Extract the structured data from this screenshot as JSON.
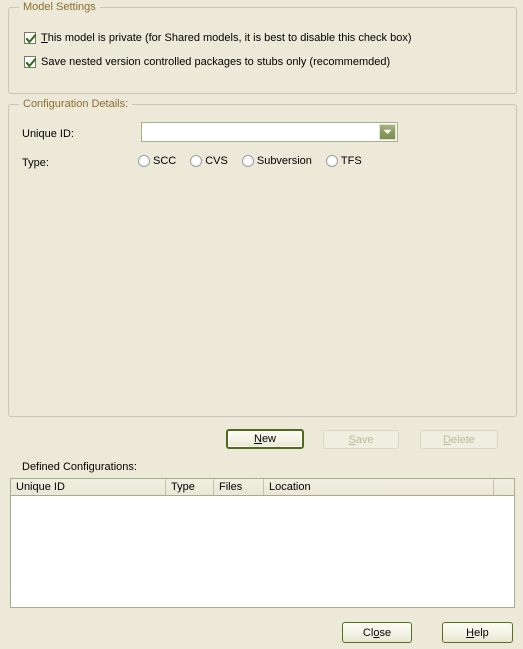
{
  "window": {
    "background_color": "#ece9d8",
    "accent_color": "#8c6d31",
    "border_color": "#a5b08a"
  },
  "model_settings": {
    "title": "Model Settings",
    "checkboxes": [
      {
        "name": "private-model",
        "mnemonic": "T",
        "label_rest": "his model is private (for Shared models, it is best to disable this check box)",
        "checked": true
      },
      {
        "name": "save-nested-stubs",
        "mnemonic": "",
        "label_rest": "Save nested version controlled packages to stubs only (recommemded)",
        "checked": true
      }
    ]
  },
  "configuration_details": {
    "title": "Configuration Details:",
    "unique_id": {
      "label": "Unique ID:",
      "value": "",
      "placeholder": ""
    },
    "type": {
      "label": "Type:",
      "options": [
        {
          "label": "SCC",
          "selected": false
        },
        {
          "label": "CVS",
          "selected": false
        },
        {
          "label": "Subversion",
          "selected": false
        },
        {
          "label": "TFS",
          "selected": false
        }
      ]
    }
  },
  "action_buttons": [
    {
      "name": "new-button",
      "mnemonic": "N",
      "label_rest": "ew",
      "state": "focused"
    },
    {
      "name": "save-button",
      "mnemonic": "S",
      "label_rest": "ave",
      "state": "disabled"
    },
    {
      "name": "delete-button",
      "mnemonic": "D",
      "label_rest": "elete",
      "state": "disabled"
    }
  ],
  "defined_configurations": {
    "label": "Defined Configurations:",
    "columns": [
      "Unique ID",
      "Type",
      "Files",
      "Location"
    ],
    "rows": []
  },
  "dialog_buttons": [
    {
      "name": "close-button",
      "pre": "Cl",
      "mnemonic": "o",
      "post": "se",
      "state": "normal"
    },
    {
      "name": "help-button",
      "pre": "",
      "mnemonic": "H",
      "post": "elp",
      "state": "normal"
    }
  ]
}
